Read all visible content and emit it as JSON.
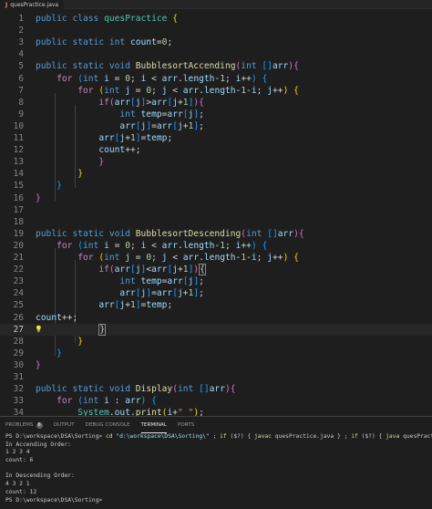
{
  "tab": {
    "icon": "J",
    "label": "quesPractice.java"
  },
  "editor_lines": [
    {
      "n": "1",
      "tokens": [
        [
          "kw",
          "public "
        ],
        [
          "kw",
          "class "
        ],
        [
          "cls",
          "quesPractice "
        ],
        [
          "b1",
          "{"
        ]
      ]
    },
    {
      "n": "2",
      "tokens": []
    },
    {
      "n": "3",
      "tokens": [
        [
          "kw",
          "public "
        ],
        [
          "kw",
          "static "
        ],
        [
          "kw",
          "int "
        ],
        [
          "id",
          "count"
        ],
        [
          "p",
          "="
        ],
        [
          "num",
          "0"
        ],
        [
          "p",
          ";"
        ]
      ]
    },
    {
      "n": "4",
      "tokens": []
    },
    {
      "n": "5",
      "tokens": [
        [
          "kw",
          "public "
        ],
        [
          "kw",
          "static "
        ],
        [
          "kw",
          "void "
        ],
        [
          "fn",
          "BubblesortAccending"
        ],
        [
          "b2",
          "("
        ],
        [
          "kw",
          "int "
        ],
        [
          "b3",
          "[]"
        ],
        [
          "id",
          "arr"
        ],
        [
          "b2",
          ")"
        ],
        [
          "b2",
          "{"
        ]
      ]
    },
    {
      "n": "6",
      "tokens": [
        [
          "p",
          "    "
        ],
        [
          "ctl",
          "for "
        ],
        [
          "b3",
          "("
        ],
        [
          "kw",
          "int "
        ],
        [
          "id",
          "i"
        ],
        [
          "p",
          " = "
        ],
        [
          "num",
          "0"
        ],
        [
          "p",
          "; "
        ],
        [
          "id",
          "i"
        ],
        [
          "p",
          " < "
        ],
        [
          "id",
          "arr"
        ],
        [
          "p",
          "."
        ],
        [
          "id",
          "length"
        ],
        [
          "p",
          "-"
        ],
        [
          "num",
          "1"
        ],
        [
          "p",
          "; "
        ],
        [
          "id",
          "i"
        ],
        [
          "p",
          "++"
        ],
        [
          "b3",
          ")"
        ],
        [
          "p",
          " "
        ],
        [
          "b3",
          "{"
        ]
      ]
    },
    {
      "n": "7",
      "tokens": [
        [
          "p",
          "        "
        ],
        [
          "ctl",
          "for "
        ],
        [
          "b1",
          "("
        ],
        [
          "kw",
          "int "
        ],
        [
          "id",
          "j"
        ],
        [
          "p",
          " = "
        ],
        [
          "num",
          "0"
        ],
        [
          "p",
          "; "
        ],
        [
          "id",
          "j"
        ],
        [
          "p",
          " < "
        ],
        [
          "id",
          "arr"
        ],
        [
          "p",
          "."
        ],
        [
          "id",
          "length"
        ],
        [
          "p",
          "-"
        ],
        [
          "num",
          "1"
        ],
        [
          "p",
          "-"
        ],
        [
          "id",
          "i"
        ],
        [
          "p",
          "; "
        ],
        [
          "id",
          "j"
        ],
        [
          "p",
          "++"
        ],
        [
          "b1",
          ")"
        ],
        [
          "p",
          " "
        ],
        [
          "b1",
          "{"
        ]
      ]
    },
    {
      "n": "8",
      "tokens": [
        [
          "p",
          "            "
        ],
        [
          "ctl",
          "if"
        ],
        [
          "b2",
          "("
        ],
        [
          "id",
          "arr"
        ],
        [
          "b3",
          "["
        ],
        [
          "id",
          "j"
        ],
        [
          "b3",
          "]"
        ],
        [
          "p",
          ">"
        ],
        [
          "id",
          "arr"
        ],
        [
          "b3",
          "["
        ],
        [
          "id",
          "j"
        ],
        [
          "p",
          "+"
        ],
        [
          "num",
          "1"
        ],
        [
          "b3",
          "]"
        ],
        [
          "b2",
          ")"
        ],
        [
          "b2",
          "{"
        ]
      ]
    },
    {
      "n": "9",
      "tokens": [
        [
          "p",
          "                "
        ],
        [
          "kw",
          "int "
        ],
        [
          "id",
          "temp"
        ],
        [
          "p",
          "="
        ],
        [
          "id",
          "arr"
        ],
        [
          "b3",
          "["
        ],
        [
          "id",
          "j"
        ],
        [
          "b3",
          "]"
        ],
        [
          "p",
          ";"
        ]
      ]
    },
    {
      "n": "10",
      "tokens": [
        [
          "p",
          "                "
        ],
        [
          "id",
          "arr"
        ],
        [
          "b3",
          "["
        ],
        [
          "id",
          "j"
        ],
        [
          "b3",
          "]"
        ],
        [
          "p",
          "="
        ],
        [
          "id",
          "arr"
        ],
        [
          "b3",
          "["
        ],
        [
          "id",
          "j"
        ],
        [
          "p",
          "+"
        ],
        [
          "num",
          "1"
        ],
        [
          "b3",
          "]"
        ],
        [
          "p",
          ";"
        ]
      ]
    },
    {
      "n": "11",
      "tokens": [
        [
          "p",
          "            "
        ],
        [
          "id",
          "arr"
        ],
        [
          "b3",
          "["
        ],
        [
          "id",
          "j"
        ],
        [
          "p",
          "+"
        ],
        [
          "num",
          "1"
        ],
        [
          "b3",
          "]"
        ],
        [
          "p",
          "="
        ],
        [
          "id",
          "temp"
        ],
        [
          "p",
          ";"
        ]
      ]
    },
    {
      "n": "12",
      "tokens": [
        [
          "p",
          "            "
        ],
        [
          "id",
          "count"
        ],
        [
          "p",
          "++;"
        ]
      ]
    },
    {
      "n": "13",
      "tokens": [
        [
          "p",
          "            "
        ],
        [
          "b2",
          "}"
        ]
      ]
    },
    {
      "n": "14",
      "tokens": [
        [
          "p",
          "        "
        ],
        [
          "b1",
          "}"
        ]
      ]
    },
    {
      "n": "15",
      "tokens": [
        [
          "p",
          "    "
        ],
        [
          "b3",
          "}"
        ]
      ]
    },
    {
      "n": "16",
      "tokens": [
        [
          "b2",
          "}"
        ]
      ]
    },
    {
      "n": "17",
      "tokens": []
    },
    {
      "n": "18",
      "tokens": []
    },
    {
      "n": "19",
      "tokens": [
        [
          "kw",
          "public "
        ],
        [
          "kw",
          "static "
        ],
        [
          "kw",
          "void "
        ],
        [
          "fn",
          "BubblesortDescending"
        ],
        [
          "b2",
          "("
        ],
        [
          "kw",
          "int "
        ],
        [
          "b3",
          "[]"
        ],
        [
          "id",
          "arr"
        ],
        [
          "b2",
          ")"
        ],
        [
          "b2",
          "{"
        ]
      ]
    },
    {
      "n": "20",
      "tokens": [
        [
          "p",
          "    "
        ],
        [
          "ctl",
          "for "
        ],
        [
          "b3",
          "("
        ],
        [
          "kw",
          "int "
        ],
        [
          "id",
          "i"
        ],
        [
          "p",
          " = "
        ],
        [
          "num",
          "0"
        ],
        [
          "p",
          "; "
        ],
        [
          "id",
          "i"
        ],
        [
          "p",
          " < "
        ],
        [
          "id",
          "arr"
        ],
        [
          "p",
          "."
        ],
        [
          "id",
          "length"
        ],
        [
          "p",
          "-"
        ],
        [
          "num",
          "1"
        ],
        [
          "p",
          "; "
        ],
        [
          "id",
          "i"
        ],
        [
          "p",
          "++"
        ],
        [
          "b3",
          ")"
        ],
        [
          "p",
          " "
        ],
        [
          "b3",
          "{"
        ]
      ]
    },
    {
      "n": "21",
      "tokens": [
        [
          "p",
          "        "
        ],
        [
          "ctl",
          "for "
        ],
        [
          "b1",
          "("
        ],
        [
          "kw",
          "int "
        ],
        [
          "id",
          "j"
        ],
        [
          "p",
          " = "
        ],
        [
          "num",
          "0"
        ],
        [
          "p",
          "; "
        ],
        [
          "id",
          "j"
        ],
        [
          "p",
          " < "
        ],
        [
          "id",
          "arr"
        ],
        [
          "p",
          "."
        ],
        [
          "id",
          "length"
        ],
        [
          "p",
          "-"
        ],
        [
          "num",
          "1"
        ],
        [
          "p",
          "-"
        ],
        [
          "id",
          "i"
        ],
        [
          "p",
          "; "
        ],
        [
          "id",
          "j"
        ],
        [
          "p",
          "++"
        ],
        [
          "b1",
          ")"
        ],
        [
          "p",
          " "
        ],
        [
          "b1",
          "{"
        ]
      ]
    },
    {
      "n": "22",
      "tokens": [
        [
          "p",
          "            "
        ],
        [
          "ctl",
          "if"
        ],
        [
          "b2",
          "("
        ],
        [
          "id",
          "arr"
        ],
        [
          "b3",
          "["
        ],
        [
          "id",
          "j"
        ],
        [
          "b3",
          "]"
        ],
        [
          "p",
          "<"
        ],
        [
          "id",
          "arr"
        ],
        [
          "b3",
          "["
        ],
        [
          "id",
          "j"
        ],
        [
          "p",
          "+"
        ],
        [
          "num",
          "1"
        ],
        [
          "b3",
          "]"
        ],
        [
          "b2",
          ")"
        ],
        [
          "cursor",
          "{"
        ]
      ]
    },
    {
      "n": "23",
      "tokens": [
        [
          "p",
          "                "
        ],
        [
          "kw",
          "int "
        ],
        [
          "id",
          "temp"
        ],
        [
          "p",
          "="
        ],
        [
          "id",
          "arr"
        ],
        [
          "b3",
          "["
        ],
        [
          "id",
          "j"
        ],
        [
          "b3",
          "]"
        ],
        [
          "p",
          ";"
        ]
      ]
    },
    {
      "n": "24",
      "tokens": [
        [
          "p",
          "                "
        ],
        [
          "id",
          "arr"
        ],
        [
          "b3",
          "["
        ],
        [
          "id",
          "j"
        ],
        [
          "b3",
          "]"
        ],
        [
          "p",
          "="
        ],
        [
          "id",
          "arr"
        ],
        [
          "b3",
          "["
        ],
        [
          "id",
          "j"
        ],
        [
          "p",
          "+"
        ],
        [
          "num",
          "1"
        ],
        [
          "b3",
          "]"
        ],
        [
          "p",
          ";"
        ]
      ]
    },
    {
      "n": "25",
      "tokens": [
        [
          "p",
          "            "
        ],
        [
          "id",
          "arr"
        ],
        [
          "b3",
          "["
        ],
        [
          "id",
          "j"
        ],
        [
          "p",
          "+"
        ],
        [
          "num",
          "1"
        ],
        [
          "b3",
          "]"
        ],
        [
          "p",
          "="
        ],
        [
          "id",
          "temp"
        ],
        [
          "p",
          ";"
        ]
      ]
    },
    {
      "n": "26",
      "tokens": [
        [
          "id",
          "count"
        ],
        [
          "p",
          "++;"
        ]
      ]
    },
    {
      "n": "27",
      "tokens": [
        [
          "p",
          "            "
        ],
        [
          "cursor",
          "}"
        ]
      ],
      "current": true,
      "bulb": true
    },
    {
      "n": "28",
      "tokens": [
        [
          "p",
          "        "
        ],
        [
          "b1",
          "}"
        ]
      ]
    },
    {
      "n": "29",
      "tokens": [
        [
          "p",
          "    "
        ],
        [
          "b3",
          "}"
        ]
      ]
    },
    {
      "n": "30",
      "tokens": [
        [
          "b2",
          "}"
        ]
      ]
    },
    {
      "n": "31",
      "tokens": []
    },
    {
      "n": "32",
      "tokens": [
        [
          "kw",
          "public "
        ],
        [
          "kw",
          "static "
        ],
        [
          "kw",
          "void "
        ],
        [
          "fn",
          "Display"
        ],
        [
          "b2",
          "("
        ],
        [
          "kw",
          "int "
        ],
        [
          "b3",
          "[]"
        ],
        [
          "id",
          "arr"
        ],
        [
          "b2",
          ")"
        ],
        [
          "b2",
          "{"
        ]
      ]
    },
    {
      "n": "33",
      "tokens": [
        [
          "p",
          "    "
        ],
        [
          "ctl",
          "for "
        ],
        [
          "b3",
          "("
        ],
        [
          "kw",
          "int "
        ],
        [
          "id",
          "i"
        ],
        [
          "p",
          " : "
        ],
        [
          "id",
          "arr"
        ],
        [
          "b3",
          ")"
        ],
        [
          "p",
          " "
        ],
        [
          "b3",
          "{"
        ]
      ]
    },
    {
      "n": "34",
      "tokens": [
        [
          "p",
          "        "
        ],
        [
          "cls",
          "System"
        ],
        [
          "p",
          "."
        ],
        [
          "id",
          "out"
        ],
        [
          "p",
          "."
        ],
        [
          "fn",
          "print"
        ],
        [
          "b1",
          "("
        ],
        [
          "id",
          "i"
        ],
        [
          "p",
          "+"
        ],
        [
          "str",
          "\" \""
        ],
        [
          "b1",
          ")"
        ],
        [
          "p",
          ";"
        ]
      ]
    }
  ],
  "panel": {
    "tabs": [
      {
        "label": "PROBLEMS",
        "badge": "6"
      },
      {
        "label": "OUTPUT"
      },
      {
        "label": "DEBUG CONSOLE"
      },
      {
        "label": "TERMINAL",
        "active": true
      },
      {
        "label": "PORTS"
      }
    ],
    "terminal_lines": [
      [
        [
          "ps",
          "PS D:\\workspace\\DSA\\Sorting> "
        ],
        [
          "cmd",
          "cd"
        ],
        [
          "plain",
          " "
        ],
        [
          "str",
          "\"d:\\workspace\\DSA\\Sorting\\\""
        ],
        [
          "plain",
          " ; "
        ],
        [
          "cmd",
          "if"
        ],
        [
          "plain",
          " ($?) { "
        ],
        [
          "cmd",
          "javac"
        ],
        [
          "plain",
          " quesPractice.java } ; "
        ],
        [
          "cmd",
          "if"
        ],
        [
          "plain",
          " ($?) { "
        ],
        [
          "cmd",
          "java"
        ],
        [
          "plain",
          " quesPractice }"
        ]
      ],
      [
        [
          "plain",
          "In Accending Order:"
        ]
      ],
      [
        [
          "plain",
          "1 2 3 4"
        ]
      ],
      [
        [
          "plain",
          "count: 6"
        ]
      ],
      [
        [
          "plain",
          ""
        ]
      ],
      [
        [
          "plain",
          "In Descending Order:"
        ]
      ],
      [
        [
          "plain",
          "4 3 2 1"
        ]
      ],
      [
        [
          "plain",
          "count: 12"
        ]
      ],
      [
        [
          "ps",
          "PS D:\\workspace\\DSA\\Sorting> "
        ]
      ]
    ]
  }
}
